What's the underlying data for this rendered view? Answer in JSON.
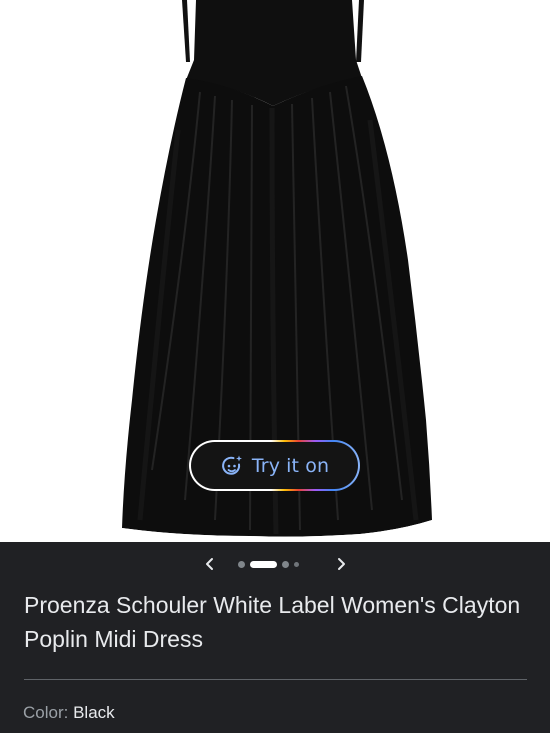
{
  "product": {
    "image_alt": "Black poplin midi dress with drop waist and gathered skirt",
    "try_on_label": "Try it on",
    "title": "Proenza Schouler White Label Women's Clayton Poplin Midi Dress",
    "color_label": "Color:",
    "color_value": "Black"
  },
  "carousel": {
    "prev_icon": "chevron-left-icon",
    "next_icon": "chevron-right-icon",
    "dot_count": 4,
    "active_index": 1
  },
  "colors": {
    "background": "#202124",
    "try_on_text": "#8ab4f8",
    "title_text": "#e8eaed",
    "muted_text": "#9aa0a6",
    "dress": "#0d0d0d"
  }
}
